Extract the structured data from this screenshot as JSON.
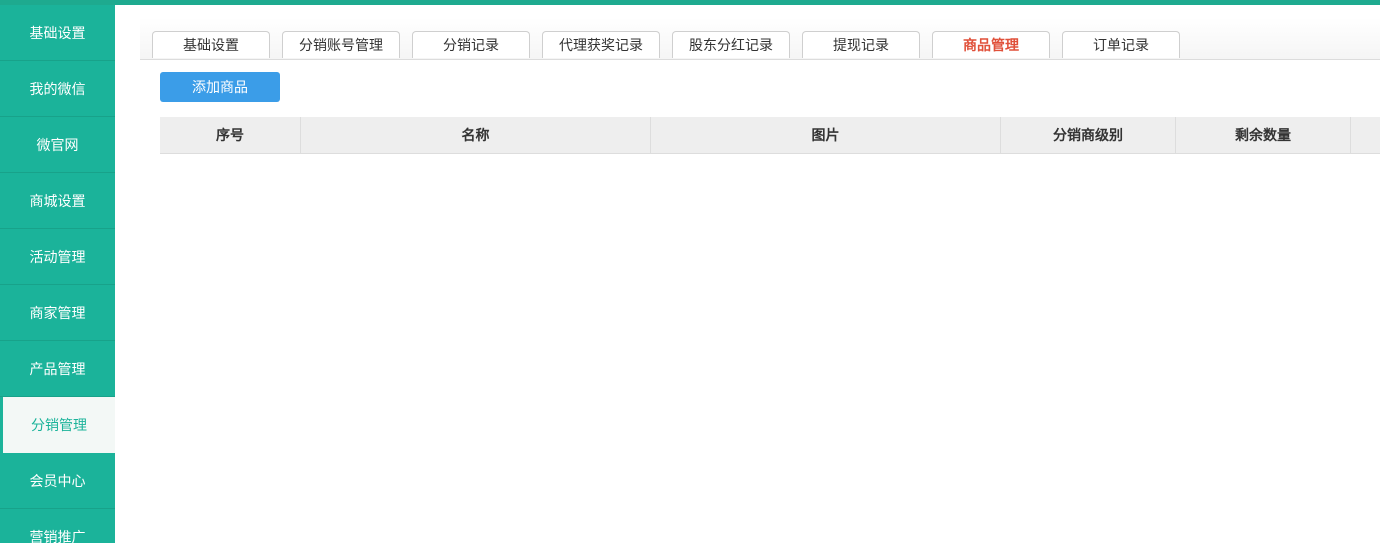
{
  "sidebar": {
    "items": [
      {
        "label": "基础设置"
      },
      {
        "label": "我的微信"
      },
      {
        "label": "微官网"
      },
      {
        "label": "商城设置"
      },
      {
        "label": "活动管理"
      },
      {
        "label": "商家管理"
      },
      {
        "label": "产品管理"
      },
      {
        "label": "分销管理",
        "active": true
      },
      {
        "label": "会员中心"
      },
      {
        "label": "营销推广"
      }
    ]
  },
  "tabs": [
    {
      "label": "基础设置"
    },
    {
      "label": "分销账号管理"
    },
    {
      "label": "分销记录"
    },
    {
      "label": "代理获奖记录"
    },
    {
      "label": "股东分红记录"
    },
    {
      "label": "提现记录"
    },
    {
      "label": "商品管理",
      "active": true
    },
    {
      "label": "订单记录"
    }
  ],
  "toolbar": {
    "add_label": "添加商品"
  },
  "table": {
    "columns": [
      "序号",
      "名称",
      "图片",
      "分销商级别",
      "剩余数量",
      ""
    ]
  },
  "colors": {
    "sidebar_bg": "#1bb39a",
    "accent_tab": "#e0503a",
    "button_blue": "#3b9de8"
  }
}
